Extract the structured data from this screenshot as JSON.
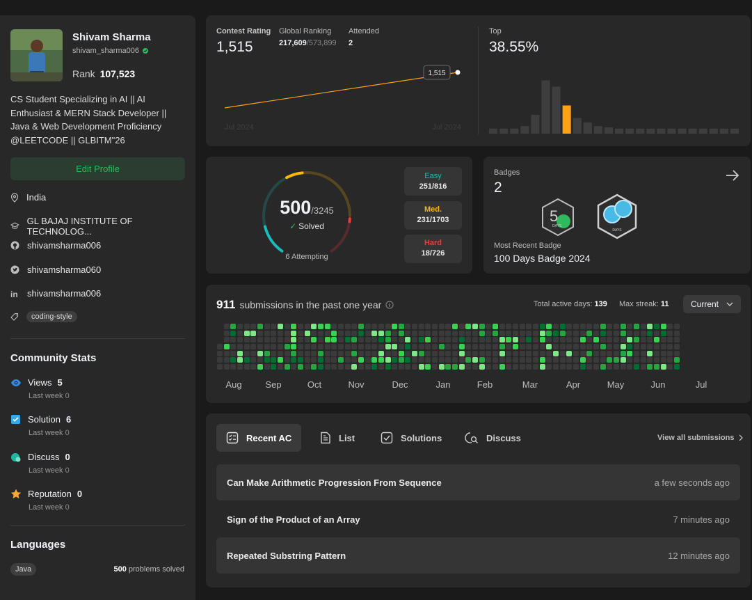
{
  "profile": {
    "name": "Shivam Sharma",
    "username": "shivam_sharma006",
    "rank_label": "Rank",
    "rank_value": "107,523",
    "bio": "CS Student Specializing in AI || AI Enthusiast & MERN Stack Developer || Java & Web Development Proficiency @LEETCODE || GLBITM\"26",
    "edit_label": "Edit Profile",
    "location": "India",
    "school": "GL BAJAJ INSTITUTE OF TECHNOLOG...",
    "github": "shivamsharma006",
    "twitter": "shivamsharma060",
    "linkedin": "shivamsharma006",
    "tag": "coding-style"
  },
  "community": {
    "title": "Community Stats",
    "items": [
      {
        "label": "Views",
        "value": "5",
        "sub_label": "Last week",
        "sub_value": "0",
        "color": "#2f8ce8"
      },
      {
        "label": "Solution",
        "value": "6",
        "sub_label": "Last week",
        "sub_value": "0",
        "color": "#36a9e8"
      },
      {
        "label": "Discuss",
        "value": "0",
        "sub_label": "Last week",
        "sub_value": "0",
        "color": "#1fb89f"
      },
      {
        "label": "Reputation",
        "value": "0",
        "sub_label": "Last week",
        "sub_value": "0",
        "color": "#f7a631"
      }
    ]
  },
  "languages": {
    "title": "Languages",
    "lang": "Java",
    "count": "500",
    "count_suffix": "problems solved"
  },
  "contest": {
    "rating_label": "Contest Rating",
    "rating": "1,515",
    "global_label": "Global Ranking",
    "global_rank": "217,609",
    "global_total": "/573,899",
    "attended_label": "Attended",
    "attended": "2",
    "tooltip": "1,515",
    "x_start": "Jul 2024",
    "x_end": "Jul 2024",
    "top_label": "Top",
    "top_value": "38.55%",
    "histogram": [
      0.08,
      0.08,
      0.08,
      0.12,
      0.3,
      0.85,
      0.75,
      0.45,
      0.25,
      0.18,
      0.12,
      0.1,
      0.08,
      0.08,
      0.08,
      0.08,
      0.08,
      0.08,
      0.08,
      0.08,
      0.08,
      0.08,
      0.08,
      0.08
    ],
    "highlight_index": 7,
    "bar_color": "#3e3e3e",
    "highlight_color": "#ffa116",
    "line_color": "#ffa116"
  },
  "solved": {
    "count": "500",
    "total": "/3245",
    "solved_label": "Solved",
    "attempting": "6 Attempting",
    "easy_label": "Easy",
    "easy_value": "251/816",
    "medium_label": "Med.",
    "medium_value": "231/1703",
    "hard_label": "Hard",
    "hard_value": "18/726",
    "easy_color": "#1cbaba",
    "medium_color": "#ffb700",
    "hard_color": "#f63737",
    "easy_frac": 0.308,
    "medium_frac": 0.136,
    "hard_frac": 0.025
  },
  "badges": {
    "label": "Badges",
    "count": "2",
    "recent_label": "Most Recent Badge",
    "recent_name": "100 Days Badge 2024",
    "badge1_text": "DAYS",
    "badge2_text": "DAYS"
  },
  "submissions": {
    "count": "911",
    "text": "submissions in the past one year",
    "active_label": "Total active days:",
    "active_value": "139",
    "streak_label": "Max streak:",
    "streak_value": "11",
    "dropdown": "Current",
    "months": [
      "Aug",
      "Sep",
      "Oct",
      "Nov",
      "Dec",
      "Jan",
      "Feb",
      "Mar",
      "Apr",
      "May",
      "Jun",
      "Jul"
    ]
  },
  "tabs": {
    "recent": "Recent AC",
    "list": "List",
    "solutions": "Solutions",
    "discuss": "Discuss",
    "view_all": "View all submissions"
  },
  "recent": [
    {
      "title": "Can Make Arithmetic Progression From Sequence",
      "time": "a few seconds ago"
    },
    {
      "title": "Sign of the Product of an Array",
      "time": "7 minutes ago"
    },
    {
      "title": "Repeated Substring Pattern",
      "time": "12 minutes ago"
    }
  ]
}
